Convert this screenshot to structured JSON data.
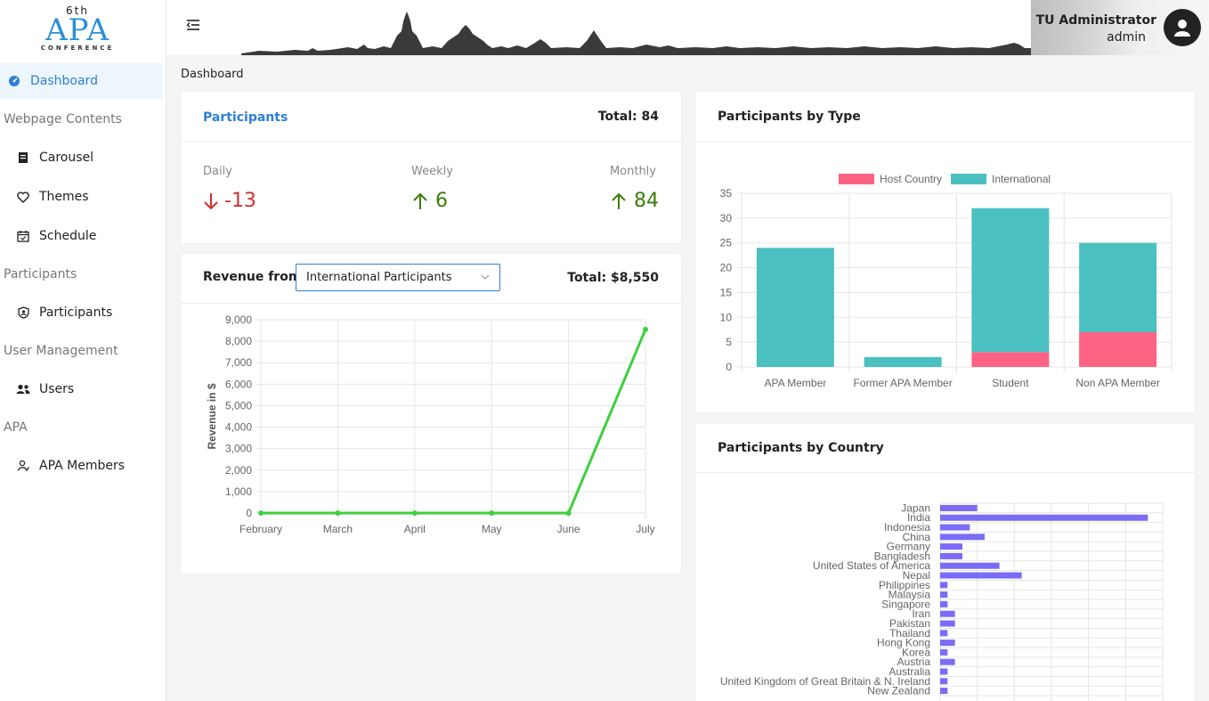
{
  "logo": {
    "sup": "6th",
    "title": "APA",
    "subtitle": "CONFERENCE"
  },
  "sidebar": {
    "dashboard": "Dashboard",
    "sections": [
      {
        "title": "Webpage Contents"
      },
      {
        "title": "Participants"
      },
      {
        "title": "User Management"
      },
      {
        "title": "APA"
      }
    ],
    "items": {
      "carousel": "Carousel",
      "themes": "Themes",
      "schedule": "Schedule",
      "participants": "Participants",
      "users": "Users",
      "apa_members": "APA Members"
    }
  },
  "header": {
    "user_name": "TU Administrator",
    "user_role": "admin"
  },
  "breadcrumb": "Dashboard",
  "participants_card": {
    "title": "Participants",
    "total": "Total: 84",
    "stats": [
      {
        "label": "Daily",
        "value": "-13",
        "trend": "down"
      },
      {
        "label": "Weekly",
        "value": "6",
        "trend": "up"
      },
      {
        "label": "Monthly",
        "value": "84",
        "trend": "up"
      }
    ]
  },
  "revenue_card": {
    "title": "Revenue from",
    "selected": "International Participants",
    "total": "Total: $8,550"
  },
  "type_card": {
    "title": "Participants by Type"
  },
  "country_card": {
    "title": "Participants by Country"
  },
  "colors": {
    "accent": "#2d7fd8",
    "host": "#ff6384",
    "international": "#4bc0c0",
    "revenue_line": "#3ecf3e",
    "country_bar": "#7b6cf6",
    "down": "#d32f2f",
    "up": "#3a7d0a"
  },
  "chart_data": [
    {
      "type": "line",
      "categories": [
        "February",
        "March",
        "April",
        "May",
        "June",
        "July"
      ],
      "values": [
        0,
        0,
        0,
        0,
        0,
        8550
      ],
      "ylabel": "Revenue in $",
      "ylim": [
        0,
        9000
      ],
      "yticks": [
        "0",
        "1,000",
        "2,000",
        "3,000",
        "4,000",
        "5,000",
        "6,000",
        "7,000",
        "8,000",
        "9,000"
      ],
      "grid": true
    },
    {
      "type": "bar",
      "stacked": true,
      "categories": [
        "APA Member",
        "Former APA Member",
        "Student",
        "Non APA Member"
      ],
      "series": [
        {
          "name": "Host Country",
          "values": [
            0,
            0,
            3,
            7
          ]
        },
        {
          "name": "International",
          "values": [
            24,
            2,
            29,
            18
          ]
        }
      ],
      "ylim": [
        0,
        35
      ],
      "yticks": [
        "0",
        "5",
        "10",
        "15",
        "20",
        "25",
        "30",
        "35"
      ],
      "legend": "top",
      "grid": true
    },
    {
      "type": "bar",
      "orientation": "horizontal",
      "categories": [
        "Japan",
        "India",
        "Indonesia",
        "China",
        "Germany",
        "Bangladesh",
        "United States of America",
        "Nepal",
        "Philippines",
        "Malaysia",
        "Singapore",
        "Iran",
        "Pakistan",
        "Thailand",
        "Hong Kong",
        "Korea",
        "Austria",
        "Australia",
        "United Kingdom of Great Britain & N. Ireland",
        "New Zealand"
      ],
      "values": [
        5,
        28,
        4,
        6,
        3,
        3,
        8,
        11,
        1,
        1,
        1,
        2,
        2,
        1,
        2,
        1,
        2,
        1,
        1,
        1
      ],
      "xlim": [
        0,
        30
      ],
      "grid": true
    }
  ]
}
